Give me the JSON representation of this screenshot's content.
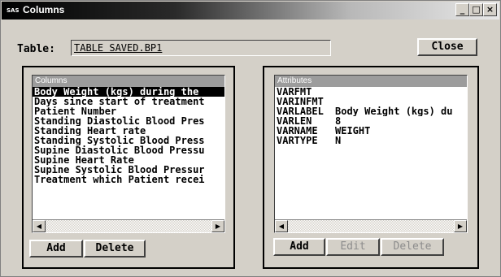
{
  "window": {
    "title": "Columns",
    "icon_text": "SAS",
    "minimize": "_",
    "maximize": "□",
    "close": "×"
  },
  "table": {
    "label": "Table:",
    "value": "TABLE SAVED.BP1"
  },
  "close_button": "Close",
  "columns_list": {
    "header": "Columns",
    "items": [
      "Body Weight (kgs) during the",
      "Days since start of treatment",
      "Patient Number",
      "Standing Diastolic Blood Pres",
      "Standing Heart rate",
      "Standing Systolic Blood Press",
      "Supine Diastolic Blood Pressu",
      "Supine Heart Rate",
      "Supine Systolic Blood Pressur",
      "Treatment which Patient recei"
    ],
    "selected_index": 0,
    "add": "Add",
    "delete": "Delete"
  },
  "attributes_list": {
    "header": "Attributes",
    "items": [
      {
        "name": "VARFMT",
        "value": ""
      },
      {
        "name": "VARINFMT",
        "value": ""
      },
      {
        "name": "VARLABEL",
        "value": "Body Weight (kgs) du"
      },
      {
        "name": "VARLEN",
        "value": "8"
      },
      {
        "name": "VARNAME",
        "value": "WEIGHT"
      },
      {
        "name": "VARTYPE",
        "value": "N"
      }
    ],
    "add": "Add",
    "edit": "Edit",
    "delete": "Delete"
  },
  "scroll": {
    "left": "◀",
    "right": "▶"
  }
}
